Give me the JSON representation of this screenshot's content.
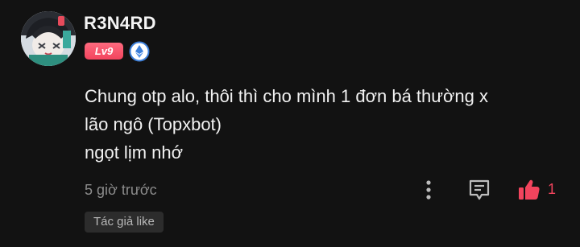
{
  "comment": {
    "username": "R3N4RD",
    "level_badge": "Lv9",
    "body_lines": [
      "Chung otp alo, thôi thì cho mình 1 đơn bá thường x",
      "lão ngô (Topxbot)",
      "ngọt lịm nhớ"
    ],
    "timestamp": "5 giờ trước",
    "like_count": "1",
    "author_liked_label": "Tác giả like"
  },
  "icons": {
    "verified_badge": "ethereum-diamond-icon",
    "more": "vertical-ellipsis-icon",
    "reply": "comment-bubble-icon",
    "like": "thumbs-up-icon"
  },
  "colors": {
    "background": "#121212",
    "accent": "#f2445d",
    "muted_text": "#8c8c8c",
    "chip_background": "#2c2c2c",
    "verified_blue": "#3d7fd8"
  }
}
